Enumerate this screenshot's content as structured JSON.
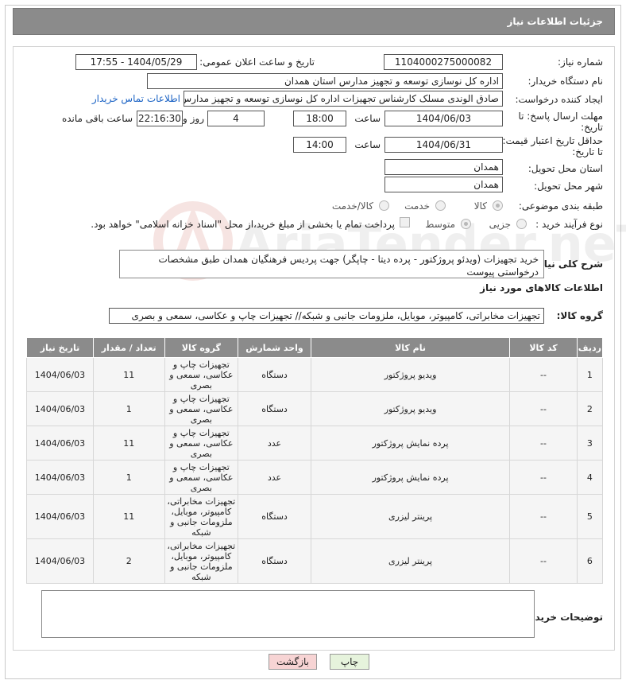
{
  "header": {
    "title": "جزئیات اطلاعات نیاز"
  },
  "watermark": {
    "text": "AriaTender.neT"
  },
  "form": {
    "need_number": {
      "label": "شماره نیاز:",
      "value": "1104000275000082"
    },
    "announce": {
      "label": "تاریخ و ساعت اعلان عمومی:",
      "value": "1404/05/29 - 17:55"
    },
    "buyer_org": {
      "label": "نام دستگاه خریدار:",
      "value": "اداره کل نوسازی توسعه و تجهیز مدارس استان همدان"
    },
    "creator": {
      "label": "ایجاد کننده درخواست:",
      "value": "صادق الوندی مسلک کارشناس تجهیزات اداره کل نوسازی توسعه و تجهیز مدارس",
      "contact_link": "اطلاعات تماس خریدار"
    },
    "reply_deadline": {
      "label_line1": "مهلت ارسال پاسخ: تا",
      "label_line2": "تاریخ:",
      "date": "1404/06/03",
      "time_label": "ساعت",
      "time": "18:00",
      "days": "4",
      "days_label": "روز و",
      "remaining": "22:16:30",
      "remaining_label": "ساعت باقی مانده"
    },
    "price_deadline": {
      "label_line1": "حداقل تاریخ اعتبار قیمت:",
      "label_line2": "تا تاریخ:",
      "date": "1404/06/31",
      "time_label": "ساعت",
      "time": "14:00"
    },
    "province": {
      "label": "استان محل تحویل:",
      "value": "همدان"
    },
    "city": {
      "label": "شهر محل تحویل:",
      "value": "همدان"
    },
    "category": {
      "label": "طبقه بندی موضوعی:",
      "options": [
        "کالا",
        "خدمت",
        "کالا/خدمت"
      ],
      "selected": "کالا"
    },
    "process": {
      "label": "نوع فرآیند خرید :",
      "options": [
        "جزیی",
        "متوسط"
      ],
      "selected": "متوسط",
      "payment_note": "پرداخت تمام یا بخشی از مبلغ خرید،از محل \"اسناد خزانه اسلامی\" خواهد بود."
    },
    "description": {
      "label": "شرح کلی نیاز:",
      "value": "خرید تجهیزات (ویدئو پروژکتور - پرده دیتا - چاپگر) جهت پردیس فرهنگیان همدان طبق مشخصات درخواستی پیوست"
    },
    "goods_section_title": "اطلاعات کالاهای مورد نیاز",
    "goods_group": {
      "label": "گروه کالا:",
      "value": "تجهیزات مخابراتی، کامپیوتر، موبایل، ملزومات جانبی و شبکه// تجهیزات چاپ و عکاسی، سمعی و بصری"
    },
    "buyer_notes": {
      "label": "توضیحات خریدار:",
      "value": ""
    }
  },
  "table": {
    "headers": [
      "ردیف",
      "کد کالا",
      "نام کالا",
      "واحد شمارش",
      "گروه کالا",
      "تعداد / مقدار",
      "تاریخ نیاز"
    ],
    "rows": [
      {
        "row": "1",
        "code": "--",
        "name": "ویدیو پروژکتور",
        "unit": "دستگاه",
        "group": "تجهیزات چاپ و عکاسی، سمعی و بصری",
        "qty": "11",
        "date": "1404/06/03"
      },
      {
        "row": "2",
        "code": "--",
        "name": "ویدیو پروژکتور",
        "unit": "دستگاه",
        "group": "تجهیزات چاپ و عکاسی، سمعی و بصری",
        "qty": "1",
        "date": "1404/06/03"
      },
      {
        "row": "3",
        "code": "--",
        "name": "پرده نمایش پروژکتور",
        "unit": "عدد",
        "group": "تجهیزات چاپ و عکاسی، سمعی و بصری",
        "qty": "11",
        "date": "1404/06/03"
      },
      {
        "row": "4",
        "code": "--",
        "name": "پرده نمایش پروژکتور",
        "unit": "عدد",
        "group": "تجهیزات چاپ و عکاسی، سمعی و بصری",
        "qty": "1",
        "date": "1404/06/03"
      },
      {
        "row": "5",
        "code": "--",
        "name": "پرینتر لیزری",
        "unit": "دستگاه",
        "group": "تجهیزات مخابراتی، کامپیوتر، موبایل، ملزومات جانبی و شبکه",
        "qty": "11",
        "date": "1404/06/03"
      },
      {
        "row": "6",
        "code": "--",
        "name": "پرینتر لیزری",
        "unit": "دستگاه",
        "group": "تجهیزات مخابراتی، کامپیوتر، موبایل، ملزومات جانبی و شبکه",
        "qty": "2",
        "date": "1404/06/03"
      }
    ]
  },
  "buttons": {
    "print": "چاپ",
    "back": "بازگشت"
  },
  "colors": {
    "header_bg": "#8b8b8b",
    "link": "#1a62c4",
    "back_button_bg": "#f7d4d4",
    "print_button_bg": "#e6f3dc"
  }
}
